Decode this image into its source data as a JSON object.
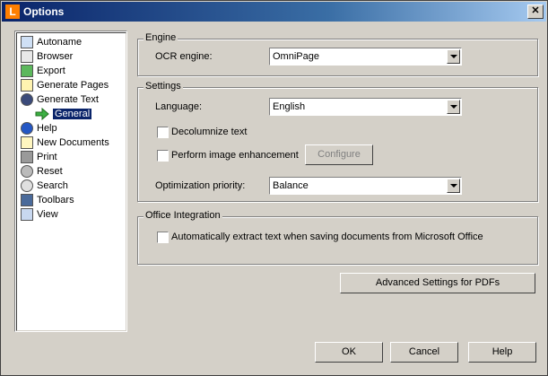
{
  "window": {
    "title": "Options",
    "app_icon_letter": "L",
    "close_glyph": "✕"
  },
  "tree": {
    "items": [
      {
        "label": "Autoname",
        "icon": "autoname-icon"
      },
      {
        "label": "Browser",
        "icon": "browser-icon"
      },
      {
        "label": "Export",
        "icon": "export-icon"
      },
      {
        "label": "Generate Pages",
        "icon": "generate-pages-icon"
      },
      {
        "label": "Generate Text",
        "icon": "generate-text-icon"
      },
      {
        "label": "General",
        "icon": "green-arrow-icon",
        "selected": true
      },
      {
        "label": "Help",
        "icon": "help-icon"
      },
      {
        "label": "New Documents",
        "icon": "new-documents-icon"
      },
      {
        "label": "Print",
        "icon": "print-icon"
      },
      {
        "label": "Reset",
        "icon": "reset-icon"
      },
      {
        "label": "Search",
        "icon": "search-icon"
      },
      {
        "label": "Toolbars",
        "icon": "toolbars-icon"
      },
      {
        "label": "View",
        "icon": "view-icon"
      }
    ]
  },
  "engine": {
    "legend": "Engine",
    "ocr_label": "OCR engine:",
    "ocr_value": "OmniPage"
  },
  "settings": {
    "legend": "Settings",
    "language_label": "Language:",
    "language_value": "English",
    "decolumnize_label": "Decolumnize text",
    "decolumnize_checked": false,
    "enhancement_label": "Perform image enhancement",
    "enhancement_checked": false,
    "configure_label": "Configure",
    "priority_label": "Optimization priority:",
    "priority_value": "Balance"
  },
  "office": {
    "legend": "Office Integration",
    "auto_extract_label": "Automatically extract text when saving documents from Microsoft Office",
    "auto_extract_checked": false
  },
  "buttons": {
    "advanced": "Advanced Settings for PDFs",
    "ok": "OK",
    "cancel": "Cancel",
    "help": "Help"
  },
  "colors": {
    "titlebar_start": "#0a246a",
    "titlebar_end": "#a6caf0",
    "app_icon": "#ff7f00",
    "selection": "#0a246a",
    "arrow_green": "#3cb043"
  }
}
